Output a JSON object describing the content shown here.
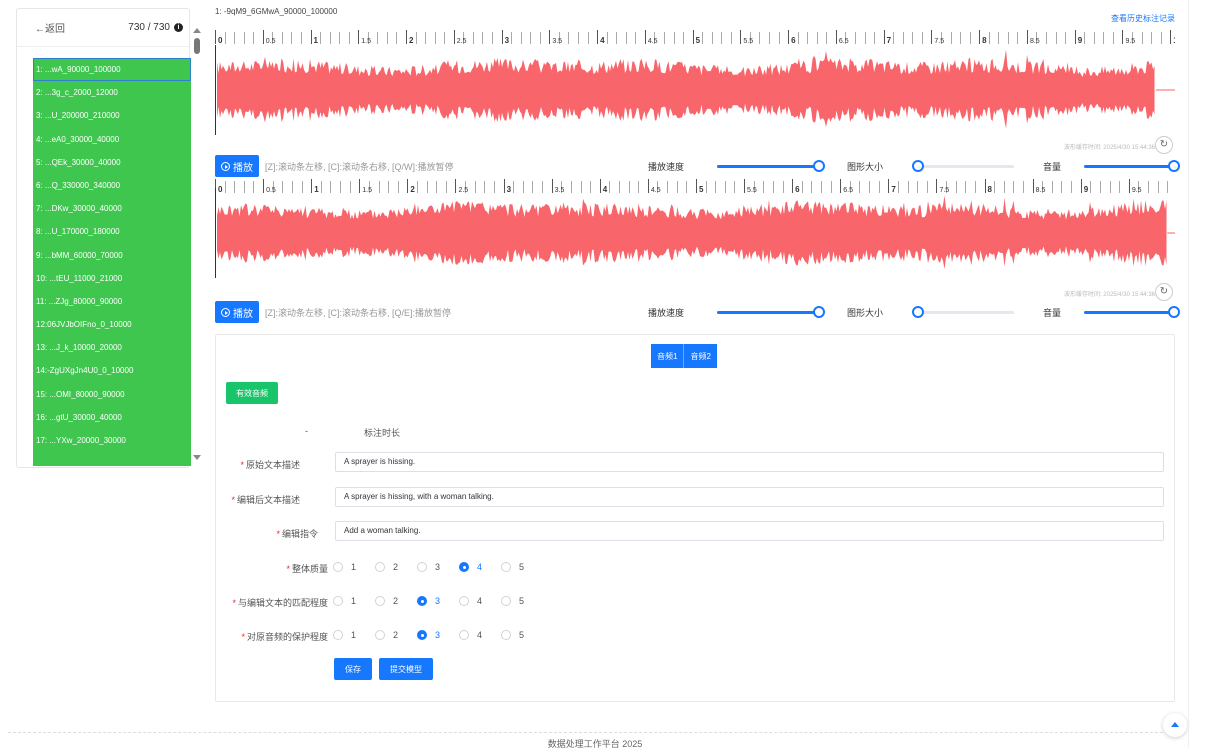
{
  "sidebar": {
    "back_label": "←返回",
    "count": "730 / 730",
    "info_icon": "i",
    "items": [
      "1: ...wA_90000_100000",
      "2: ...3g_c_2000_12000",
      "3: ...U_200000_210000",
      "4: ...eA0_30000_40000",
      "5: ...QEk_30000_40000",
      "6: ...Q_330000_340000",
      "7: ...DKw_30000_40000",
      "8: ...U_170000_180000",
      "9: ...bMM_60000_70000",
      "10: ...tEU_11000_21000",
      "11: ...ZJg_80000_90000",
      "12:06JVJbOIFno_0_10000",
      "13: ...J_k_10000_20000",
      "14:-ZgUXgJn4U0_0_10000",
      "15: ...OMI_80000_90000",
      "16: ...gtU_30000_40000",
      "17: ...YXw_20000_30000"
    ]
  },
  "header": {
    "file_title": "1: -9qM9_6GMwA_90000_100000",
    "history_link": "查看历史标注记录"
  },
  "waveforms": [
    {
      "ticks": [
        {
          "v": 0,
          "t": "0"
        },
        {
          "v": 0.5,
          "t": "0.5"
        },
        {
          "v": 1,
          "t": "1"
        },
        {
          "v": 1.5,
          "t": "1.5"
        },
        {
          "v": 2,
          "t": "2"
        },
        {
          "v": 2.5,
          "t": "2.5"
        },
        {
          "v": 3,
          "t": "3"
        },
        {
          "v": 3.5,
          "t": "3.5"
        },
        {
          "v": 4,
          "t": "4"
        },
        {
          "v": 4.5,
          "t": "4.5"
        },
        {
          "v": 5,
          "t": "5"
        },
        {
          "v": 5.5,
          "t": "5.5"
        },
        {
          "v": 6,
          "t": "6"
        },
        {
          "v": 6.5,
          "t": "6.5"
        },
        {
          "v": 7,
          "t": "7"
        },
        {
          "v": 7.5,
          "t": "7.5"
        },
        {
          "v": 8,
          "t": "8"
        },
        {
          "v": 8.5,
          "t": "8.5"
        },
        {
          "v": 9,
          "t": "9"
        },
        {
          "v": 9.5,
          "t": "9.5"
        },
        {
          "v": 10,
          "t": "10"
        }
      ],
      "max_time": 10.05,
      "end_time": 9.85,
      "wave_color": "#f8656a",
      "autosave": "波形缓存时间: 2025/4/30 15:44:36",
      "play_label": "播放",
      "hint": "[Z]:滚动条左移, [C]:滚动条右移, [Q/W]:播放暂停",
      "speed_label": "播放速度",
      "size_label": "图形大小",
      "volume_label": "音量",
      "speed": 1.0,
      "size": 0.0,
      "volume": 1.0
    },
    {
      "ticks": [
        {
          "v": 0,
          "t": "0"
        },
        {
          "v": 0.5,
          "t": "0.5"
        },
        {
          "v": 1,
          "t": "1"
        },
        {
          "v": 1.5,
          "t": "1.5"
        },
        {
          "v": 2,
          "t": "2"
        },
        {
          "v": 2.5,
          "t": "2.5"
        },
        {
          "v": 3,
          "t": "3"
        },
        {
          "v": 3.5,
          "t": "3.5"
        },
        {
          "v": 4,
          "t": "4"
        },
        {
          "v": 4.5,
          "t": "4.5"
        },
        {
          "v": 5,
          "t": "5"
        },
        {
          "v": 5.5,
          "t": "5.5"
        },
        {
          "v": 6,
          "t": "6"
        },
        {
          "v": 6.5,
          "t": "6.5"
        },
        {
          "v": 7,
          "t": "7"
        },
        {
          "v": 7.5,
          "t": "7.5"
        },
        {
          "v": 8,
          "t": "8"
        },
        {
          "v": 8.5,
          "t": "8.5"
        },
        {
          "v": 9,
          "t": "9"
        },
        {
          "v": 9.5,
          "t": "9.5"
        }
      ],
      "max_time": 9.98,
      "end_time": 9.9,
      "wave_color": "#f8656a",
      "autosave": "波形缓存时间: 2025/4/30 15:44:36",
      "play_label": "播放",
      "hint": "[Z]:滚动条左移, [C]:滚动条右移, [Q/E]:播放暂停",
      "speed_label": "播放速度",
      "size_label": "图形大小",
      "volume_label": "音量",
      "speed": 1.0,
      "size": 0.0,
      "volume": 1.0
    }
  ],
  "form": {
    "tabs": [
      "音频1",
      "音频2"
    ],
    "valid_button": "有效音频",
    "duration_label": "标注时长",
    "duration_value": "-",
    "original_label": "原始文本描述",
    "original_value": "A sprayer is hissing.",
    "edited_label": "编辑后文本描述",
    "edited_value": "A sprayer is hissing, with a woman talking.",
    "instruction_label": "编辑指令",
    "instruction_value": "Add a woman talking.",
    "ratings": [
      {
        "label": "整体质量",
        "selected": 4
      },
      {
        "label": "与编辑文本的匹配程度",
        "selected": 3
      },
      {
        "label": "对原音频的保护程度",
        "selected": 3
      }
    ],
    "options": [
      "1",
      "2",
      "3",
      "4",
      "5"
    ],
    "save_label": "保存",
    "submit_label": "提交模型"
  },
  "footer": {
    "text": "数据处理工作平台 2025"
  },
  "colors": {
    "accent": "#1677ff",
    "list_bg": "#3fc64f",
    "valid_btn": "#19c56a",
    "wave": "#f8656a"
  }
}
